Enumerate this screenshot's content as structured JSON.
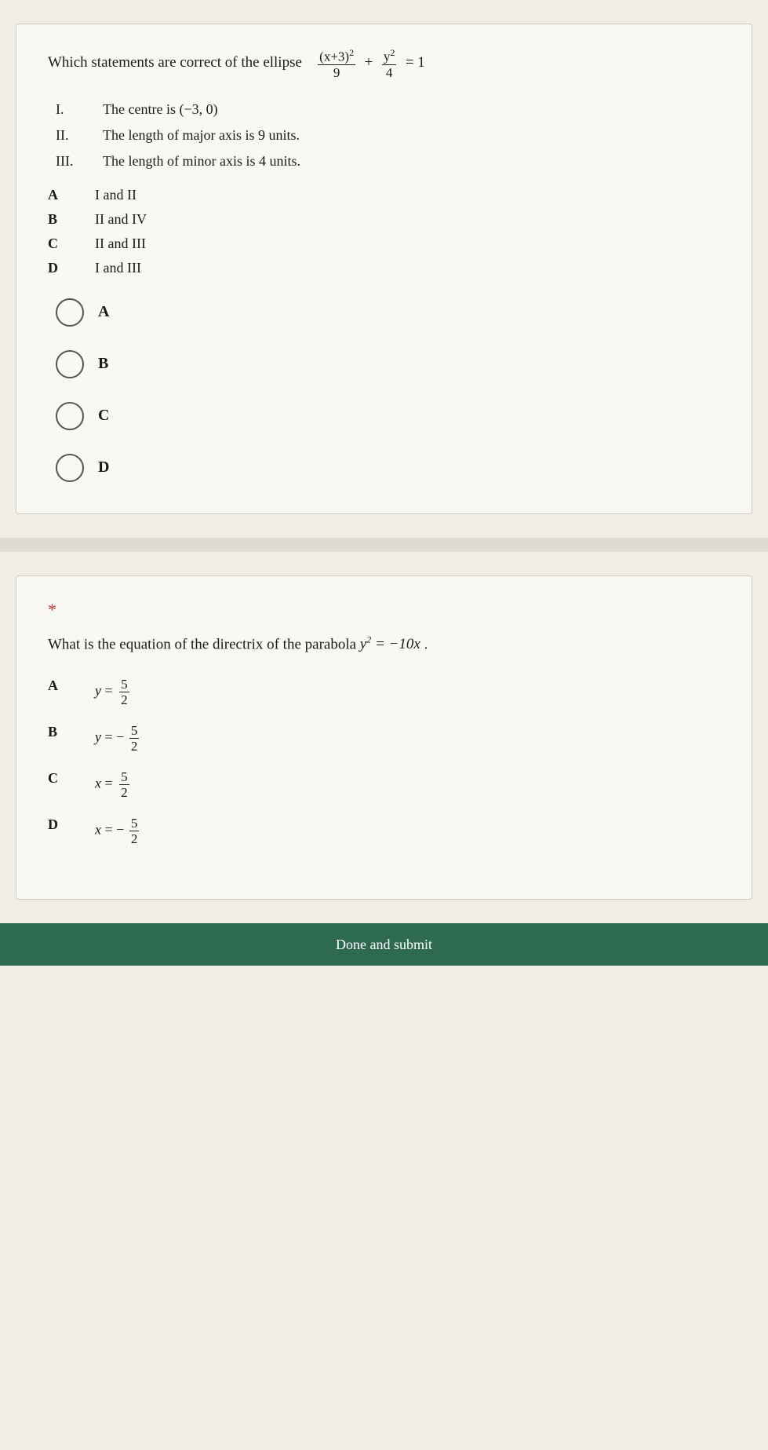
{
  "question1": {
    "intro": "Which statements are correct of the ellipse",
    "formula": {
      "numerator1": "(x+3)",
      "exp1": "2",
      "denom1": "9",
      "plus": "+",
      "numerator2": "y",
      "exp2": "2",
      "denom2": "4",
      "equals": "= 1"
    },
    "statements": [
      {
        "label": "I.",
        "text": "The centre is (−3, 0)"
      },
      {
        "label": "II.",
        "text": "The length of major axis is 9 units."
      },
      {
        "label": "III.",
        "text": "The length of minor axis is 4 units."
      }
    ],
    "options": [
      {
        "label": "A",
        "text": "I and II"
      },
      {
        "label": "B",
        "text": "II and IV"
      },
      {
        "label": "C",
        "text": "II and III"
      },
      {
        "label": "D",
        "text": "I and III"
      }
    ],
    "choices": [
      "A",
      "B",
      "C",
      "D"
    ]
  },
  "question2": {
    "star": "*",
    "text": "What is the equation of the directrix of the parabola",
    "parabola": "y² = −10x",
    "period": ".",
    "options": [
      {
        "label": "A",
        "formula": "y = 5/2"
      },
      {
        "label": "B",
        "formula": "y = −5/2"
      },
      {
        "label": "C",
        "formula": "x = 5/2"
      },
      {
        "label": "D",
        "formula": "x = −5/2"
      }
    ],
    "bottom_button": "Done and submit"
  }
}
